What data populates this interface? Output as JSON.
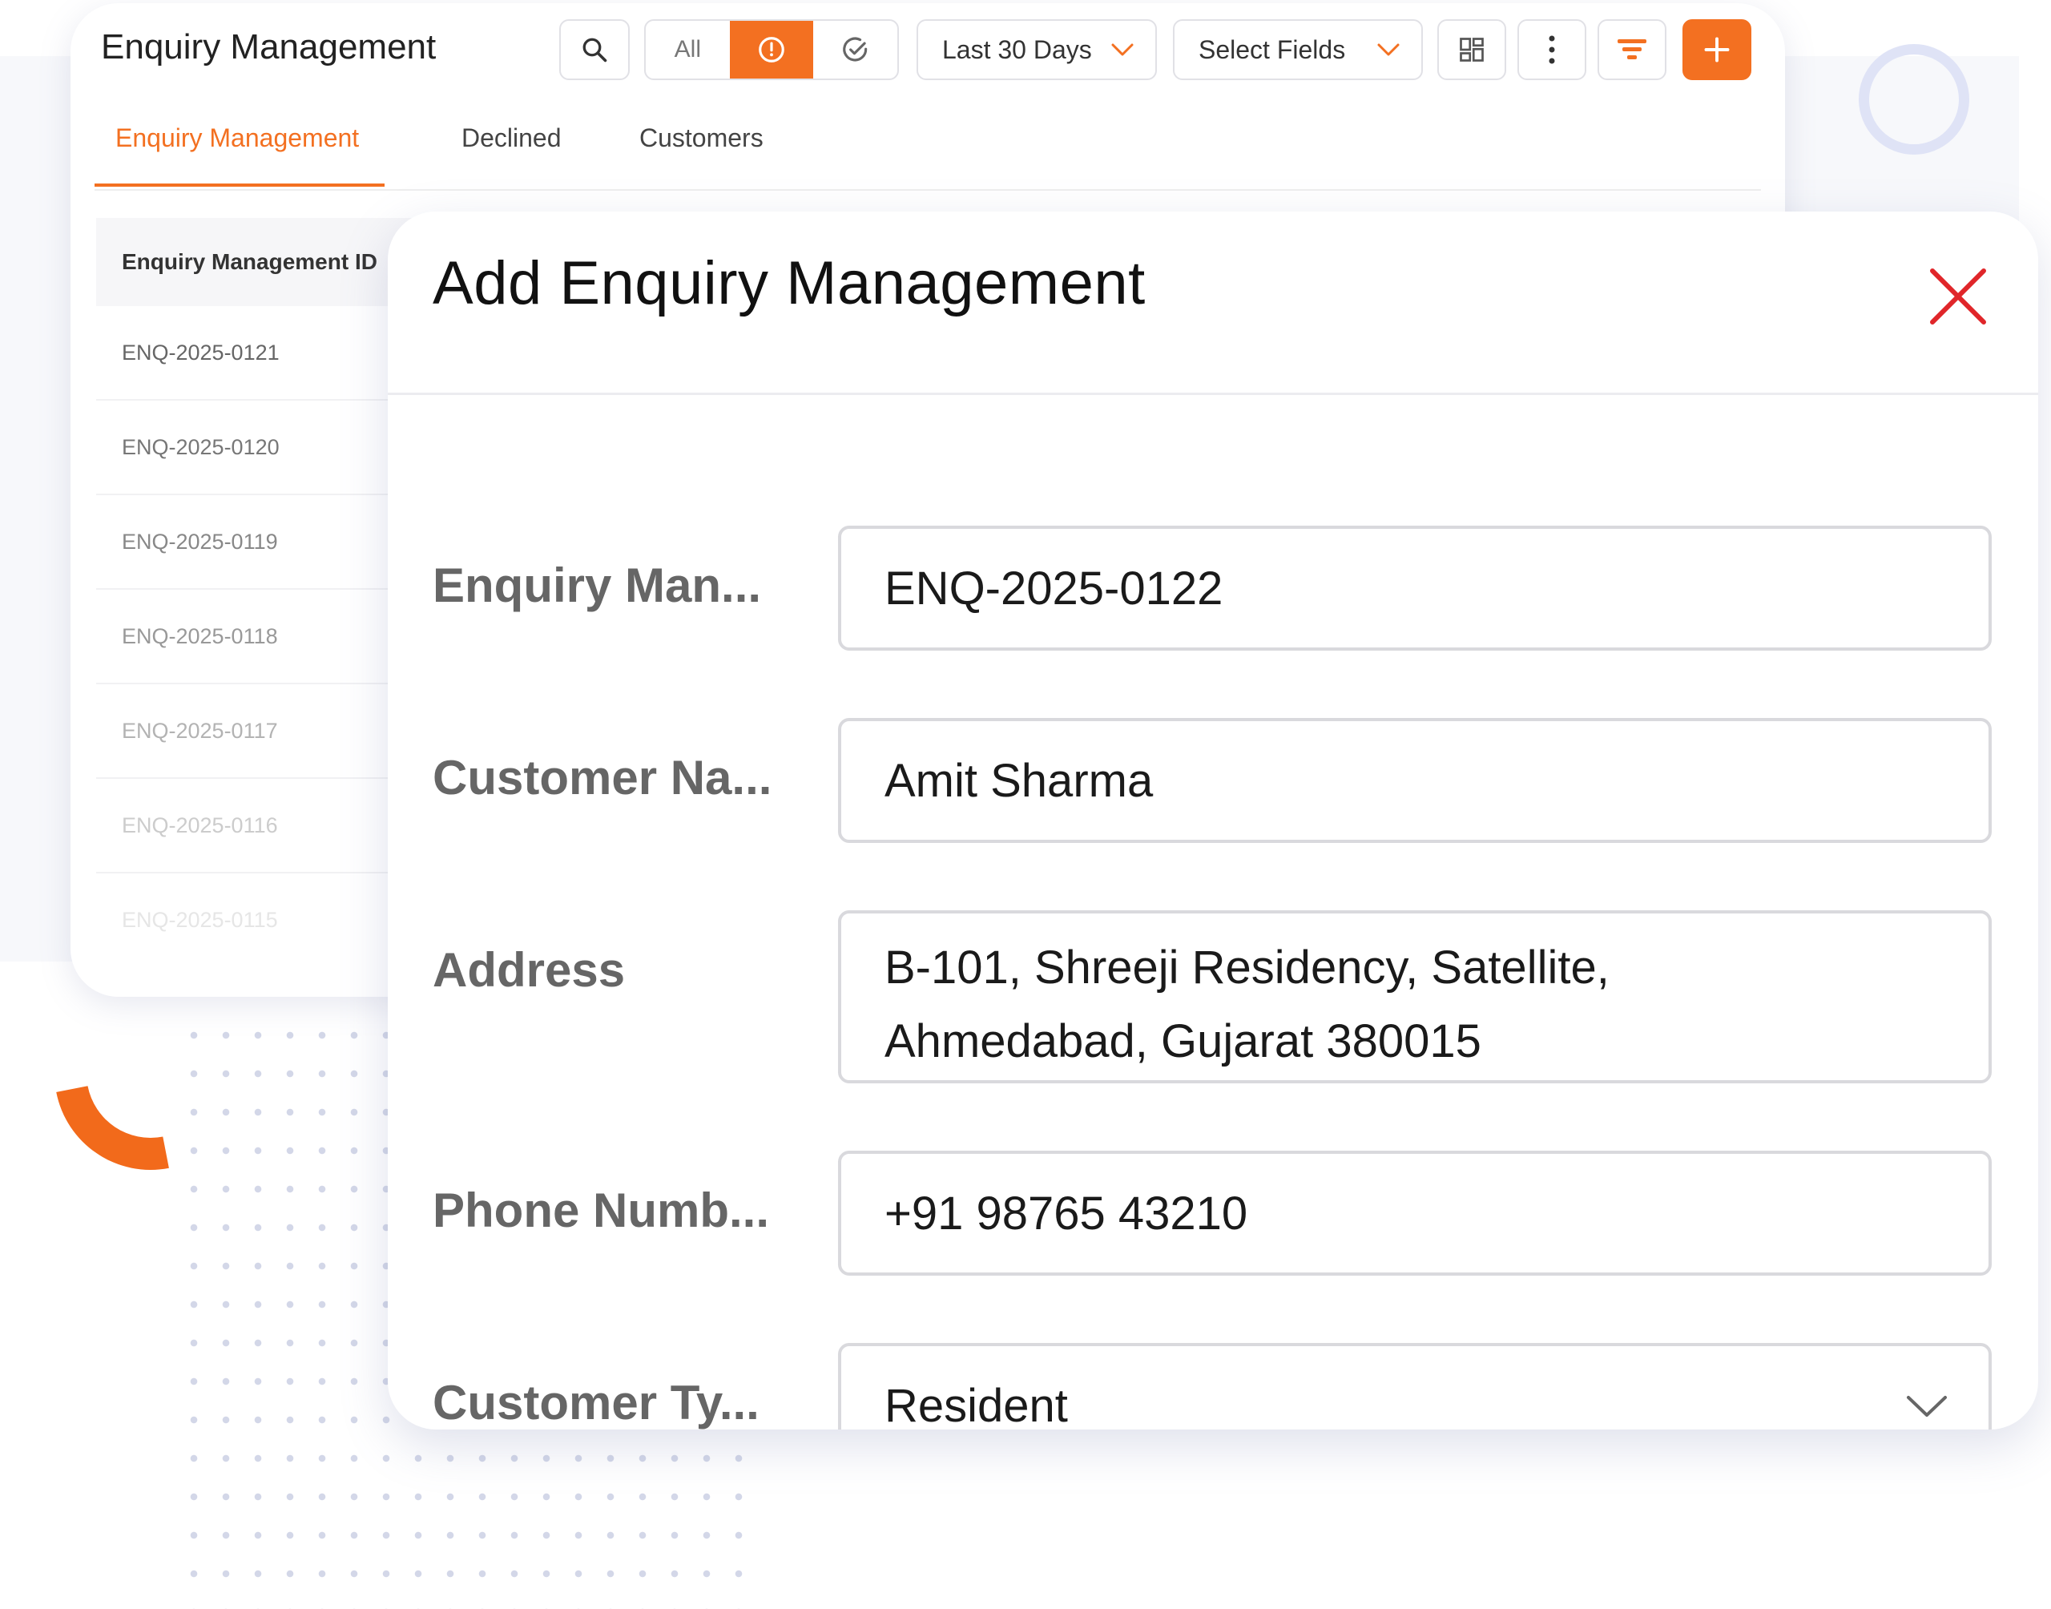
{
  "app": {
    "title": "Enquiry Management"
  },
  "toolbar": {
    "search_icon": "search-icon",
    "filter_all_label": "All",
    "filter_pending_icon": "clock-icon",
    "filter_done_icon": "check-circle-icon",
    "date_range_label": "Last 30 Days",
    "select_fields_label": "Select Fields",
    "grid_view_icon": "grid-icon",
    "more_icon": "more-vertical-icon",
    "filter_icon": "filter-icon",
    "add_icon": "plus-icon",
    "accent_color": "#f37021"
  },
  "tabs": [
    {
      "label": "Enquiry Management",
      "active": true
    },
    {
      "label": "Declined",
      "active": false
    },
    {
      "label": "Customers",
      "active": false
    }
  ],
  "table": {
    "header": "Enquiry Management ID",
    "rows": [
      "ENQ-2025-0121",
      "ENQ-2025-0120",
      "ENQ-2025-0119",
      "ENQ-2025-0118",
      "ENQ-2025-0117",
      "ENQ-2025-0116",
      "ENQ-2025-0115"
    ]
  },
  "modal": {
    "title": "Add Enquiry Management",
    "close_icon": "close-icon",
    "close_color": "#e0262a",
    "fields": [
      {
        "label": "Enquiry Man...",
        "value": "ENQ-2025-0122"
      },
      {
        "label": "Customer Na...",
        "value": "Amit Sharma"
      },
      {
        "label": "Address",
        "value": "B-101, Shreeji Residency, Satellite,\nAhmedabad, Gujarat 380015"
      },
      {
        "label": "Phone Numb...",
        "value": "+91 98765 43210"
      },
      {
        "label": "Customer Ty...",
        "value": "Resident"
      }
    ]
  }
}
